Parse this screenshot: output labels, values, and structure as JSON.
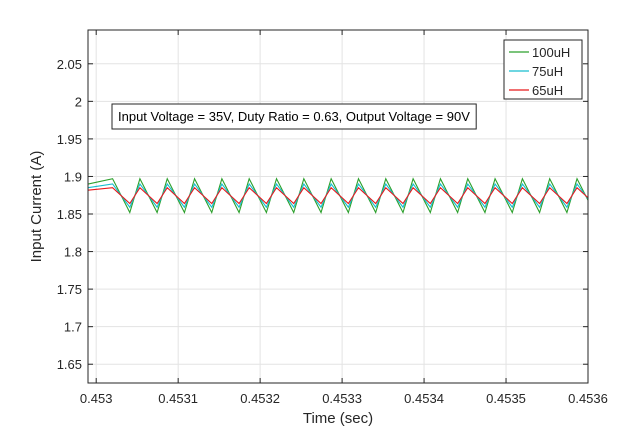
{
  "chart_data": {
    "type": "line",
    "xlabel": "Time (sec)",
    "ylabel": "Input Current (A)",
    "xlim": [
      0.45299,
      0.4536
    ],
    "ylim": [
      1.625,
      2.095
    ],
    "x_ticks": [
      0.453,
      0.4531,
      0.4532,
      0.4533,
      0.4534,
      0.4535,
      0.4536
    ],
    "x_tick_labels": [
      "0.453",
      "0.4531",
      "0.4532",
      "0.4533",
      "0.4534",
      "0.4535",
      "0.4536"
    ],
    "y_ticks": [
      1.65,
      1.7,
      1.75,
      1.8,
      1.85,
      1.9,
      1.95,
      2.0,
      2.05
    ],
    "y_tick_labels": [
      "1.65",
      "1.7",
      "1.75",
      "1.8",
      "1.85",
      "1.9",
      "1.95",
      "2",
      "2.05"
    ],
    "grid": true,
    "legend_position": "top-right",
    "annotation": "Input Voltage = 35V, Duty Ratio = 0.63, Output Voltage = 90V",
    "waveform": {
      "period": 3.333e-05,
      "first_peak": 0.45302,
      "duty_ratio": 0.63,
      "start": 0.45299,
      "end": 0.4536
    },
    "series": [
      {
        "name": "100uH",
        "color": "#2ca02c",
        "min": 1.852,
        "max": 1.897
      },
      {
        "name": "75uH",
        "color": "#17becf",
        "min": 1.859,
        "max": 1.89
      },
      {
        "name": "65uH",
        "color": "#e8191b",
        "min": 1.864,
        "max": 1.885
      }
    ]
  }
}
